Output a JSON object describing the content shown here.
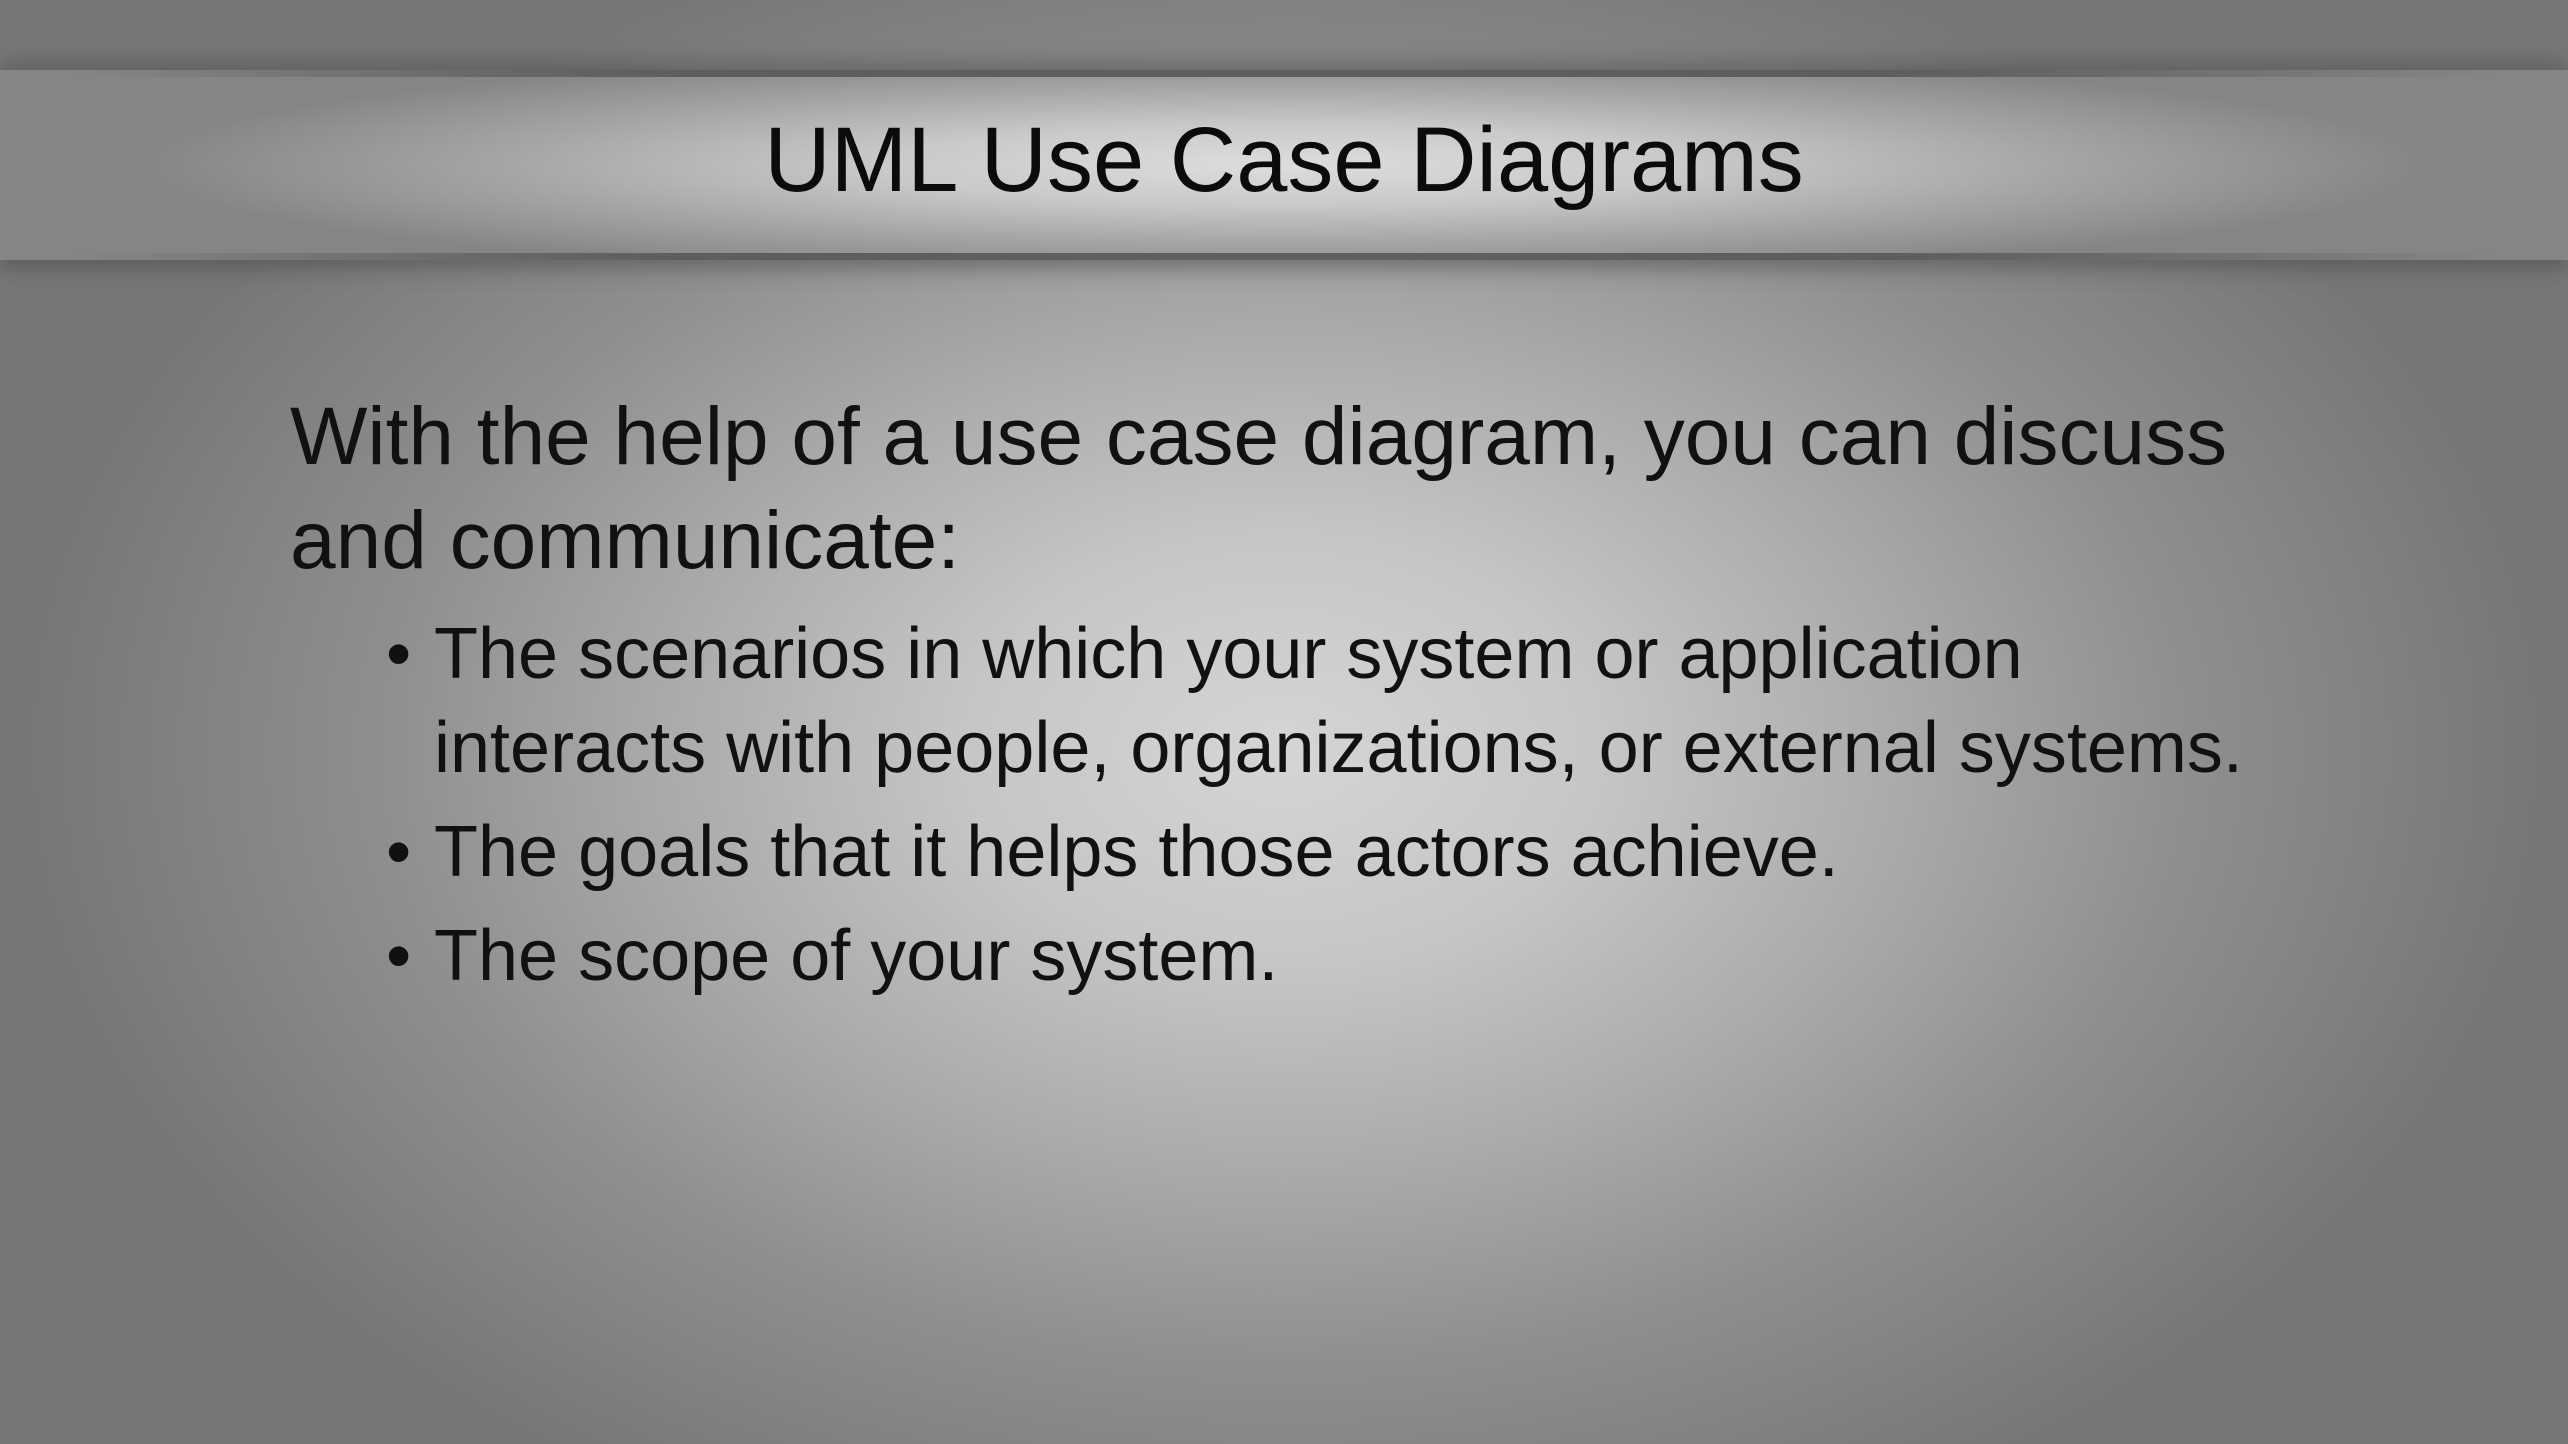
{
  "slide": {
    "title": "UML Use Case Diagrams",
    "intro": "With the help of a use case diagram, you can discuss and communicate:",
    "bullets": [
      "The scenarios in which your system or application interacts with people, organizations, or external systems.",
      "The goals that it helps those actors achieve.",
      "The scope of your system."
    ]
  }
}
